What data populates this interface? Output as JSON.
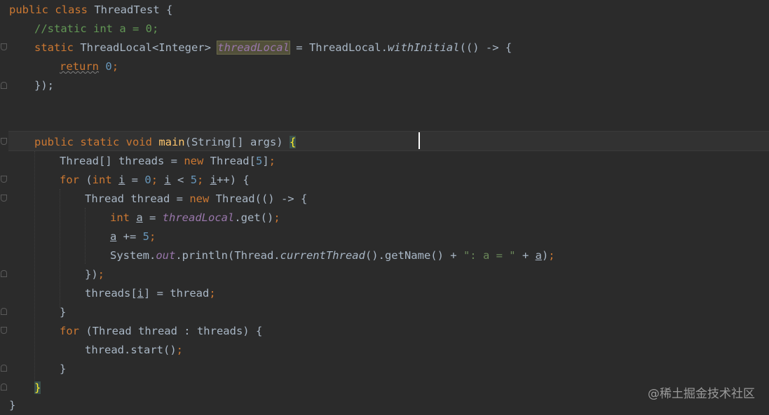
{
  "editor": {
    "lines": [
      {
        "id": "l1",
        "tokens": [
          {
            "t": "public class ",
            "c": "kw"
          },
          {
            "t": "ThreadTest {",
            "c": ""
          }
        ]
      },
      {
        "id": "l2",
        "tokens": [
          {
            "t": "//static int a = 0;",
            "c": "cm"
          }
        ]
      },
      {
        "id": "l3",
        "tokens": [
          {
            "t": "static ",
            "c": "kw"
          },
          {
            "t": "ThreadLocal<Integer> ",
            "c": ""
          },
          {
            "t": "threadLocal",
            "c": "fld hl"
          },
          {
            "t": " = ThreadLocal.",
            "c": ""
          },
          {
            "t": "withInitial",
            "c": "sfn"
          },
          {
            "t": "(() -> {",
            "c": ""
          }
        ]
      },
      {
        "id": "l4",
        "tokens": [
          {
            "t": "return",
            "c": "kw wav"
          },
          {
            "t": " ",
            "c": ""
          },
          {
            "t": "0",
            "c": "num"
          },
          {
            "t": ";",
            "c": "kw"
          }
        ]
      },
      {
        "id": "l5",
        "tokens": [
          {
            "t": "});",
            "c": ""
          }
        ]
      },
      {
        "id": "l6",
        "tokens": []
      },
      {
        "id": "l7",
        "tokens": []
      },
      {
        "id": "l8",
        "tokens": [
          {
            "t": "public static void ",
            "c": "kw"
          },
          {
            "t": "main",
            "c": "mth"
          },
          {
            "t": "(String[] args) ",
            "c": ""
          },
          {
            "t": "{",
            "c": "brace-hl"
          }
        ]
      },
      {
        "id": "l9",
        "tokens": [
          {
            "t": "Thread[] threads = ",
            "c": ""
          },
          {
            "t": "new ",
            "c": "kw"
          },
          {
            "t": "Thread[",
            "c": ""
          },
          {
            "t": "5",
            "c": "num"
          },
          {
            "t": "]",
            "c": ""
          },
          {
            "t": ";",
            "c": "kw"
          }
        ]
      },
      {
        "id": "l10",
        "tokens": [
          {
            "t": "for ",
            "c": "kw"
          },
          {
            "t": "(",
            "c": ""
          },
          {
            "t": "int ",
            "c": "kw"
          },
          {
            "t": "i",
            "c": "ul"
          },
          {
            "t": " = ",
            "c": ""
          },
          {
            "t": "0",
            "c": "num"
          },
          {
            "t": "; ",
            "c": "kw"
          },
          {
            "t": "i",
            "c": "ul"
          },
          {
            "t": " < ",
            "c": ""
          },
          {
            "t": "5",
            "c": "num"
          },
          {
            "t": "; ",
            "c": "kw"
          },
          {
            "t": "i",
            "c": "ul"
          },
          {
            "t": "++) {",
            "c": ""
          }
        ]
      },
      {
        "id": "l11",
        "tokens": [
          {
            "t": "Thread thread = ",
            "c": ""
          },
          {
            "t": "new ",
            "c": "kw"
          },
          {
            "t": "Thread(() -> {",
            "c": ""
          }
        ]
      },
      {
        "id": "l12",
        "tokens": [
          {
            "t": "int ",
            "c": "kw"
          },
          {
            "t": "a",
            "c": "ul"
          },
          {
            "t": " = ",
            "c": ""
          },
          {
            "t": "threadLocal",
            "c": "fld"
          },
          {
            "t": ".get()",
            "c": ""
          },
          {
            "t": ";",
            "c": "kw"
          }
        ]
      },
      {
        "id": "l13",
        "tokens": [
          {
            "t": "a",
            "c": "ul"
          },
          {
            "t": " += ",
            "c": ""
          },
          {
            "t": "5",
            "c": "num"
          },
          {
            "t": ";",
            "c": "kw"
          }
        ]
      },
      {
        "id": "l14",
        "tokens": [
          {
            "t": "System.",
            "c": ""
          },
          {
            "t": "out",
            "c": "fld"
          },
          {
            "t": ".println(Thread.",
            "c": ""
          },
          {
            "t": "currentThread",
            "c": "sfn"
          },
          {
            "t": "().getName() + ",
            "c": ""
          },
          {
            "t": "\": a = \"",
            "c": "str"
          },
          {
            "t": " + ",
            "c": ""
          },
          {
            "t": "a",
            "c": "ul"
          },
          {
            "t": ")",
            "c": ""
          },
          {
            "t": ";",
            "c": "kw"
          }
        ]
      },
      {
        "id": "l15",
        "tokens": [
          {
            "t": "})",
            "c": ""
          },
          {
            "t": ";",
            "c": "kw"
          }
        ]
      },
      {
        "id": "l16",
        "tokens": [
          {
            "t": "threads[",
            "c": ""
          },
          {
            "t": "i",
            "c": "ul"
          },
          {
            "t": "] = thread",
            "c": ""
          },
          {
            "t": ";",
            "c": "kw"
          }
        ]
      },
      {
        "id": "l17",
        "tokens": [
          {
            "t": "}",
            "c": ""
          }
        ]
      },
      {
        "id": "l18",
        "tokens": [
          {
            "t": "for ",
            "c": "kw"
          },
          {
            "t": "(Thread thread : threads) {",
            "c": ""
          }
        ]
      },
      {
        "id": "l19",
        "tokens": [
          {
            "t": "thread.start()",
            "c": ""
          },
          {
            "t": ";",
            "c": "kw"
          }
        ]
      },
      {
        "id": "l20",
        "tokens": [
          {
            "t": "}",
            "c": ""
          }
        ]
      },
      {
        "id": "l21",
        "tokens": [
          {
            "t": "}",
            "c": "brace-hl"
          }
        ]
      },
      {
        "id": "l22",
        "tokens": [
          {
            "t": "}",
            "c": ""
          }
        ]
      }
    ]
  },
  "watermark": {
    "text": "@稀土掘金技术社区"
  },
  "colors": {
    "background": "#2b2b2b",
    "keyword": "#cc7832",
    "comment": "#629755",
    "number": "#6897bb",
    "string": "#6a8759",
    "field": "#9876aa",
    "method": "#ffc66d",
    "text": "#a9b7c6"
  }
}
